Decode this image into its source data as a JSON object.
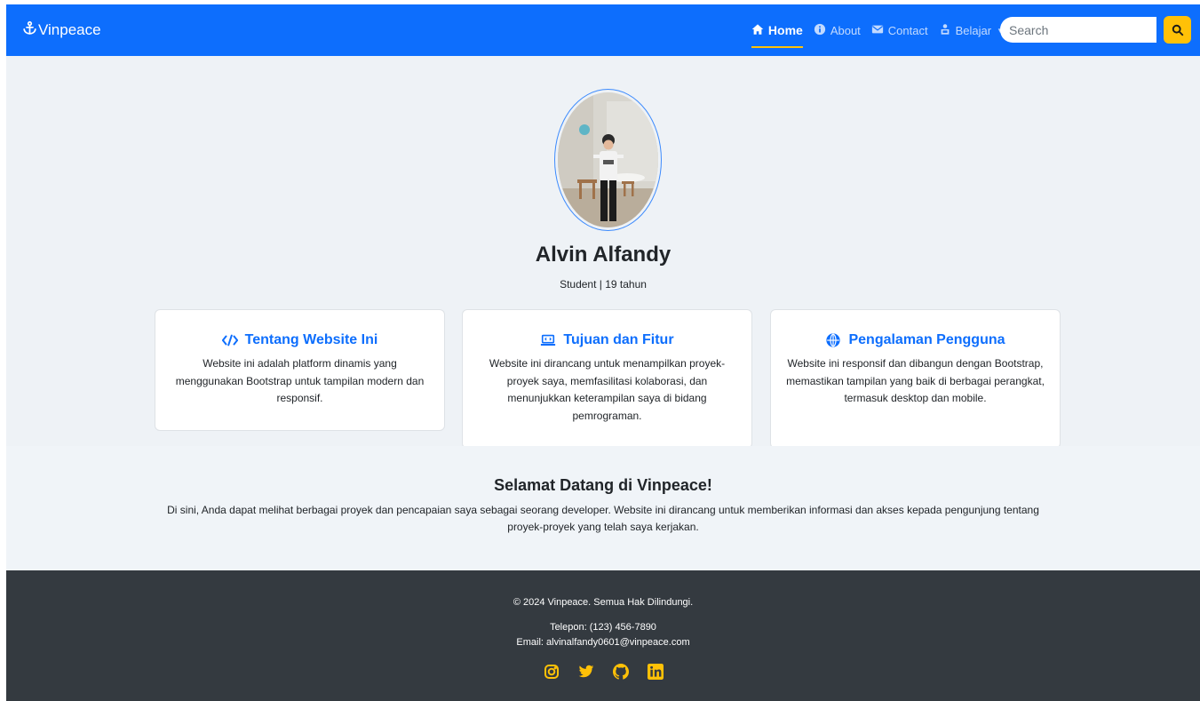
{
  "navbar": {
    "brand": "Vinpeace",
    "items": [
      {
        "label": "Home",
        "icon": "home-icon",
        "active": true
      },
      {
        "label": "About",
        "icon": "info-icon",
        "active": false
      },
      {
        "label": "Contact",
        "icon": "envelope-icon",
        "active": false
      },
      {
        "label": "Belajar",
        "icon": "user-study-icon",
        "active": false,
        "dropdown": true
      }
    ],
    "search_placeholder": "Search",
    "search_icon": "search-icon"
  },
  "profile": {
    "name": "Alvin Alfandy",
    "subtitle": "Student | 19 tahun"
  },
  "cards": [
    {
      "icon": "code-icon",
      "title": "Tentang Website Ini",
      "text": "Website ini adalah platform dinamis yang menggunakan Bootstrap untuk tampilan modern dan responsif."
    },
    {
      "icon": "laptop-code-icon",
      "title": "Tujuan dan Fitur",
      "text": "Website ini dirancang untuk menampilkan proyek-proyek saya, memfasilitasi kolaborasi, dan menunjukkan keterampilan saya di bidang pemrograman."
    },
    {
      "icon": "globe-icon",
      "title": "Pengalaman Pengguna",
      "text": "Website ini responsif dan dibangun dengan Bootstrap, memastikan tampilan yang baik di berbagai perangkat, termasuk desktop dan mobile."
    }
  ],
  "welcome": {
    "title": "Selamat Datang di Vinpeace!",
    "text": "Di sini, Anda dapat melihat berbagai proyek dan pencapaian saya sebagai seorang developer. Website ini dirancang untuk memberikan informasi dan akses kepada pengunjung tentang proyek-proyek yang telah saya kerjakan."
  },
  "footer": {
    "copyright": "© 2024 Vinpeace. Semua Hak Dilindungi.",
    "phone": "Telepon: (123) 456-7890",
    "email": "Email: alvinalfandy0601@vinpeace.com",
    "socials": [
      "instagram-icon",
      "twitter-icon",
      "github-icon",
      "linkedin-icon"
    ]
  },
  "colors": {
    "primary": "#0d6efd",
    "accent": "#ffc107",
    "footer_bg": "#343a40",
    "page_bg": "#eef2f6"
  }
}
